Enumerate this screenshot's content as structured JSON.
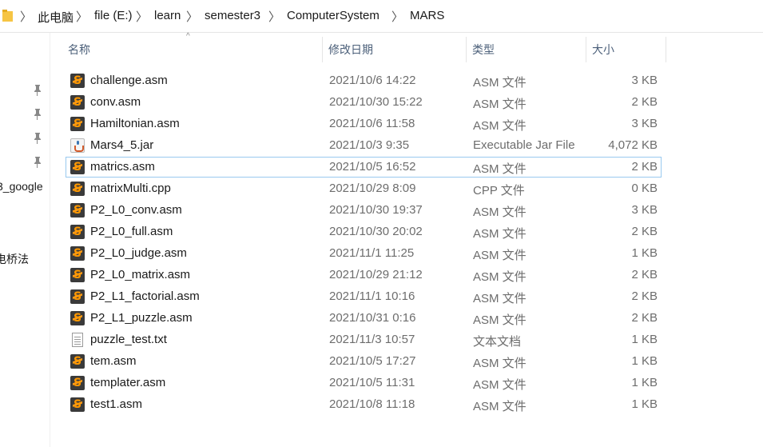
{
  "breadcrumb": [
    "此电脑",
    "file (E:)",
    "learn",
    "semester3",
    "ComputerSystem",
    "MARS"
  ],
  "breadcrumb_separator": "〉",
  "nav": {
    "item1": "3_google",
    "item2": "电桥法"
  },
  "columns": {
    "name": "名称",
    "date": "修改日期",
    "type": "类型",
    "size": "大小"
  },
  "files": [
    {
      "name": "challenge.asm",
      "date": "2021/10/6 14:22",
      "type": "ASM 文件",
      "size": "3 KB",
      "icon": "sublime-file-icon"
    },
    {
      "name": "conv.asm",
      "date": "2021/10/30 15:22",
      "type": "ASM 文件",
      "size": "2 KB",
      "icon": "sublime-file-icon"
    },
    {
      "name": "Hamiltonian.asm",
      "date": "2021/10/6 11:58",
      "type": "ASM 文件",
      "size": "3 KB",
      "icon": "sublime-file-icon"
    },
    {
      "name": "Mars4_5.jar",
      "date": "2021/10/3 9:35",
      "type": "Executable Jar File",
      "size": "4,072 KB",
      "icon": "java-jar-icon"
    },
    {
      "name": "matrics.asm",
      "date": "2021/10/5 16:52",
      "type": "ASM 文件",
      "size": "2 KB",
      "icon": "sublime-file-icon"
    },
    {
      "name": "matrixMulti.cpp",
      "date": "2021/10/29 8:09",
      "type": "CPP 文件",
      "size": "0 KB",
      "icon": "sublime-file-icon"
    },
    {
      "name": "P2_L0_conv.asm",
      "date": "2021/10/30 19:37",
      "type": "ASM 文件",
      "size": "3 KB",
      "icon": "sublime-file-icon"
    },
    {
      "name": "P2_L0_full.asm",
      "date": "2021/10/30 20:02",
      "type": "ASM 文件",
      "size": "2 KB",
      "icon": "sublime-file-icon"
    },
    {
      "name": "P2_L0_judge.asm",
      "date": "2021/11/1 11:25",
      "type": "ASM 文件",
      "size": "1 KB",
      "icon": "sublime-file-icon"
    },
    {
      "name": "P2_L0_matrix.asm",
      "date": "2021/10/29 21:12",
      "type": "ASM 文件",
      "size": "2 KB",
      "icon": "sublime-file-icon"
    },
    {
      "name": "P2_L1_factorial.asm",
      "date": "2021/11/1 10:16",
      "type": "ASM 文件",
      "size": "2 KB",
      "icon": "sublime-file-icon"
    },
    {
      "name": "P2_L1_puzzle.asm",
      "date": "2021/10/31 0:16",
      "type": "ASM 文件",
      "size": "2 KB",
      "icon": "sublime-file-icon"
    },
    {
      "name": "puzzle_test.txt",
      "date": "2021/11/3 10:57",
      "type": "文本文档",
      "size": "1 KB",
      "icon": "text-file-icon"
    },
    {
      "name": "tem.asm",
      "date": "2021/10/5 17:27",
      "type": "ASM 文件",
      "size": "1 KB",
      "icon": "sublime-file-icon"
    },
    {
      "name": "templater.asm",
      "date": "2021/10/5 11:31",
      "type": "ASM 文件",
      "size": "1 KB",
      "icon": "sublime-file-icon"
    },
    {
      "name": "test1.asm",
      "date": "2021/10/8 11:18",
      "type": "ASM 文件",
      "size": "1 KB",
      "icon": "sublime-file-icon"
    }
  ]
}
